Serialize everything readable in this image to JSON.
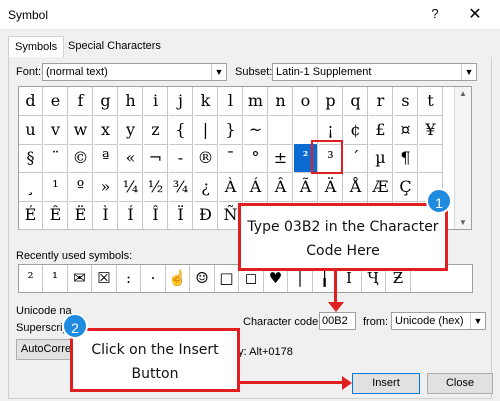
{
  "window": {
    "title": "Symbol",
    "help": "?",
    "close": "✕"
  },
  "tabs": [
    {
      "label": "Symbols",
      "accesskey": "S"
    },
    {
      "label": "Special Characters",
      "accesskey": "P"
    }
  ],
  "font": {
    "label": "Font:",
    "value": "(normal text)"
  },
  "subset": {
    "label": "Subset:",
    "value": "Latin-1 Supplement"
  },
  "symbol_grid": {
    "rows": [
      [
        "d",
        "e",
        "f",
        "g",
        "h",
        "i",
        "j",
        "k",
        "l",
        "m",
        "n",
        "o",
        "p",
        "q",
        "r",
        "s",
        "t"
      ],
      [
        "u",
        "v",
        "w",
        "x",
        "y",
        "z",
        "{",
        "|",
        "}",
        "~",
        "",
        "",
        "¡",
        "¢",
        "£",
        "¤",
        "¥"
      ],
      [
        "§",
        "¨",
        "©",
        "ª",
        "«",
        "¬",
        "-",
        "®",
        "¯",
        "°",
        "±",
        "²",
        "³",
        "´",
        "µ",
        "¶",
        ""
      ],
      [
        "¸",
        "¹",
        "º",
        "»",
        "¼",
        "½",
        "¾",
        "¿",
        "À",
        "Á",
        "Â",
        "Ã",
        "Ä",
        "Å",
        "Æ",
        "Ç",
        ""
      ],
      [
        "É",
        "Ê",
        "Ë",
        "Ì",
        "Í",
        "Î",
        "Ï",
        "Đ",
        "Ñ",
        "Ò",
        "Ó",
        "",
        "",
        "",
        "",
        "Ø",
        "Ù"
      ]
    ],
    "right_column": [
      "",
      "¦",
      "·",
      "È",
      "Ú"
    ],
    "selected": "²"
  },
  "recent": {
    "label": "Recently used symbols:",
    "items": [
      "²",
      "¹",
      "✉",
      "☒",
      ":",
      "·",
      "☝",
      "☺",
      "□",
      "◻",
      "♥",
      "│",
      "╽",
      "Ї",
      "Ҷ",
      "Ƶ"
    ]
  },
  "unicode_name": {
    "label": "Unicode na",
    "value": "Superscrip"
  },
  "character_code": {
    "label": "Character code:",
    "value": "00B2"
  },
  "from": {
    "label": "from:",
    "value": "Unicode (hex)"
  },
  "autocorrect_label": "AutoCorre",
  "shortcut_text": "ey: Alt+0178",
  "buttons": {
    "insert": "Insert",
    "close": "Close"
  },
  "callout_1": {
    "text": "Type 03B2 in the Character Code Here",
    "badge": "1"
  },
  "callout_2": {
    "text": "Click on the Insert Button",
    "badge": "2"
  },
  "colors": {
    "accent": "#0b6bd3",
    "annotation": "#e02020",
    "badge": "#1f8be0"
  }
}
